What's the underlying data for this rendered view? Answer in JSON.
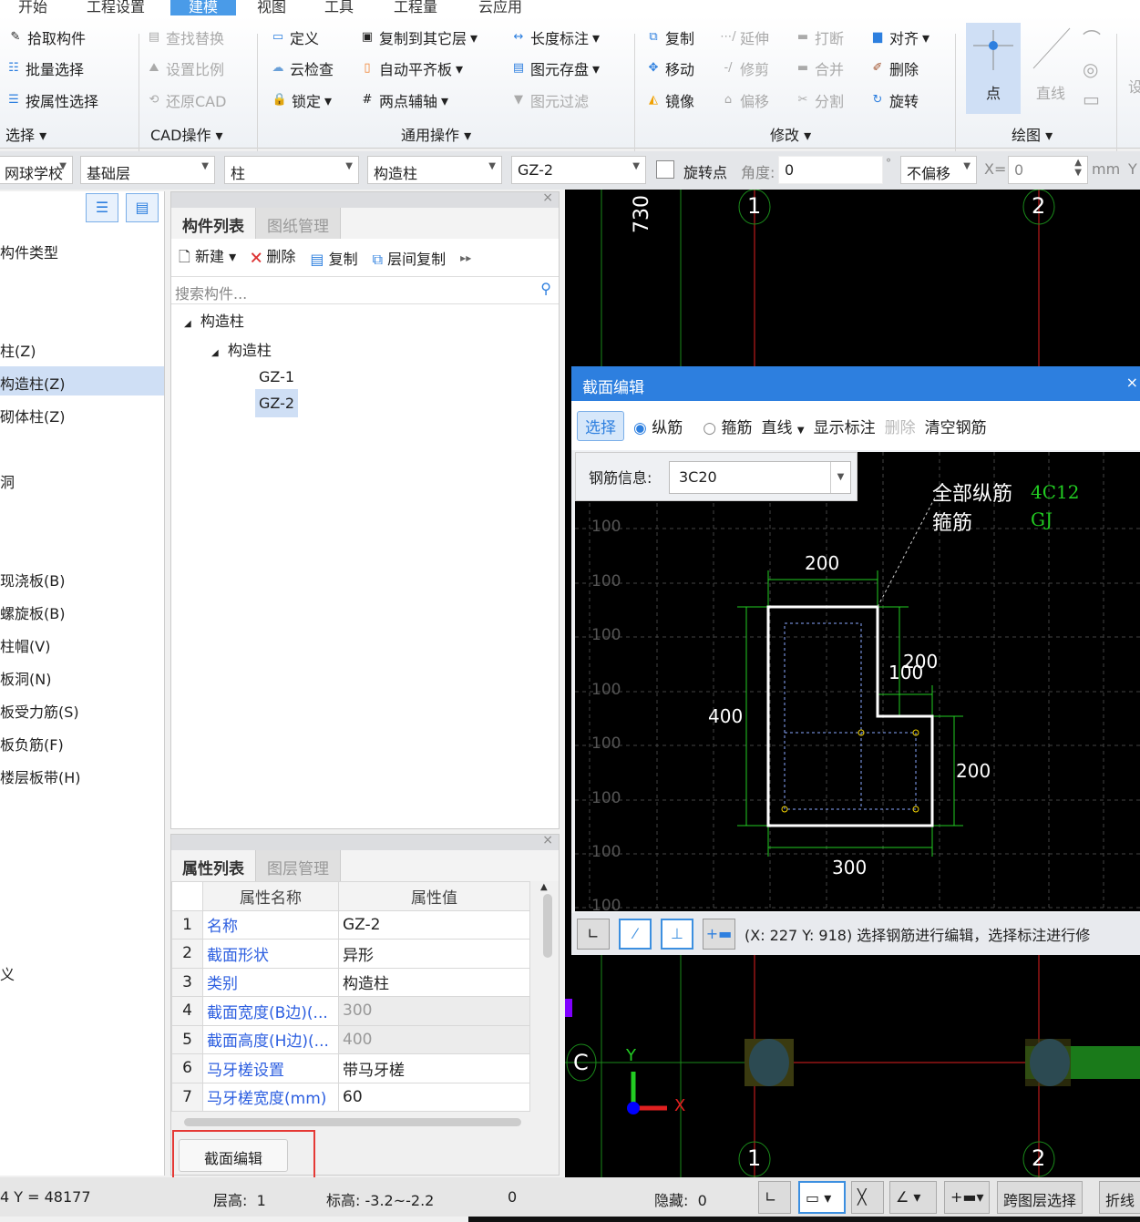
{
  "menu": {
    "tabs": [
      "开始",
      "工程设置",
      "建模",
      "视图",
      "工具",
      "工程量",
      "云应用"
    ],
    "active": "建模"
  },
  "ribbon": {
    "select": {
      "items": [
        "拾取构件",
        "批量选择",
        "按属性选择"
      ],
      "group": "选择"
    },
    "cad": {
      "items": [
        "查找替换",
        "设置比例",
        "还原CAD"
      ],
      "group": "CAD操作"
    },
    "common": {
      "items": [
        "定义",
        "云检查",
        "锁定",
        "复制到其它层",
        "自动平齐板",
        "两点辅轴",
        "长度标注",
        "图元存盘",
        "图元过滤"
      ],
      "group": "通用操作"
    },
    "modify": {
      "items": [
        "复制",
        "移动",
        "镜像",
        "延伸",
        "修剪",
        "偏移",
        "打断",
        "合并",
        "分割",
        "对齐",
        "删除",
        "旋转"
      ],
      "group": "修改"
    },
    "draw": {
      "items": [
        "点",
        "直线"
      ],
      "group": "绘图"
    },
    "cut": "设"
  },
  "toolbar": {
    "project": "网球学校",
    "floor": "基础层",
    "type": "柱",
    "subtype": "构造柱",
    "component": "GZ-2",
    "rotate_label": "旋转点",
    "angle_label": "角度:",
    "angle": "0",
    "deg": "°",
    "offset": "不偏移",
    "x_label": "X=",
    "x": "0",
    "unit": "mm",
    "y_label": "Y"
  },
  "left": {
    "items": [
      "构件类型",
      "柱(Z)",
      "构造柱(Z)",
      "砌体柱(Z)",
      "洞",
      "现浇板(B)",
      "螺旋板(B)",
      "柱帽(V)",
      "板洞(N)",
      "板受力筋(S)",
      "板负筋(F)",
      "楼层板带(H)",
      "义"
    ],
    "selected": "构造柱(Z)"
  },
  "components": {
    "tabs": [
      "构件列表",
      "图纸管理"
    ],
    "actions": [
      "新建",
      "删除",
      "复制",
      "层间复制"
    ],
    "search_placeholder": "搜索构件...",
    "tree": {
      "root": "构造柱",
      "child": "构造柱",
      "leaves": [
        "GZ-1",
        "GZ-2"
      ],
      "selected": "GZ-2"
    }
  },
  "properties": {
    "tabs": [
      "属性列表",
      "图层管理"
    ],
    "headers": [
      "属性名称",
      "属性值"
    ],
    "rows": [
      [
        "1",
        "名称",
        "GZ-2"
      ],
      [
        "2",
        "截面形状",
        "异形"
      ],
      [
        "3",
        "类别",
        "构造柱"
      ],
      [
        "4",
        "截面宽度(B边)(...",
        "300"
      ],
      [
        "5",
        "截面高度(H边)(...",
        "400"
      ],
      [
        "6",
        "马牙槎设置",
        "带马牙槎"
      ],
      [
        "7",
        "马牙槎宽度(mm)",
        "60"
      ]
    ],
    "button": "截面编辑"
  },
  "dialog": {
    "title": "截面编辑",
    "tools": {
      "select": "选择",
      "long": "纵筋",
      "stirrup": "箍筋",
      "line": "直线",
      "show_dim": "显示标注",
      "delete": "删除",
      "clear": "清空钢筋"
    },
    "rebar_label": "钢筋信息:",
    "rebar_value": "3C20",
    "annot": {
      "all_long": "全部纵筋",
      "all_long_val": "4C12",
      "stirrup": "箍筋",
      "stirrup_val": "GJ"
    },
    "dims": [
      "200",
      "100",
      "200",
      "400",
      "200",
      "300"
    ],
    "grid_label": "100",
    "status": "(X: 227 Y: 918) 选择钢筋进行编辑，选择标注进行修"
  },
  "canvas": {
    "axis_labels": [
      "1",
      "2",
      "C"
    ],
    "dim": "730",
    "x_axis": "X",
    "y_axis": "Y"
  },
  "status": {
    "coord": "4 Y = 48177",
    "floor_h_label": "层高:",
    "floor_h": "1",
    "elev_label": "标高:",
    "elev": "-3.2~-2.2",
    "zero": "0",
    "hidden_label": "隐藏:",
    "hidden": "0",
    "btn1": "跨图层选择",
    "btn2": "折线"
  },
  "colors": {
    "accent": "#2d7fdf",
    "selected_bg": "#cfdff5",
    "dim_green": "#22cc22",
    "axis_red": "#e02020",
    "highlight_red": "#e53935"
  }
}
